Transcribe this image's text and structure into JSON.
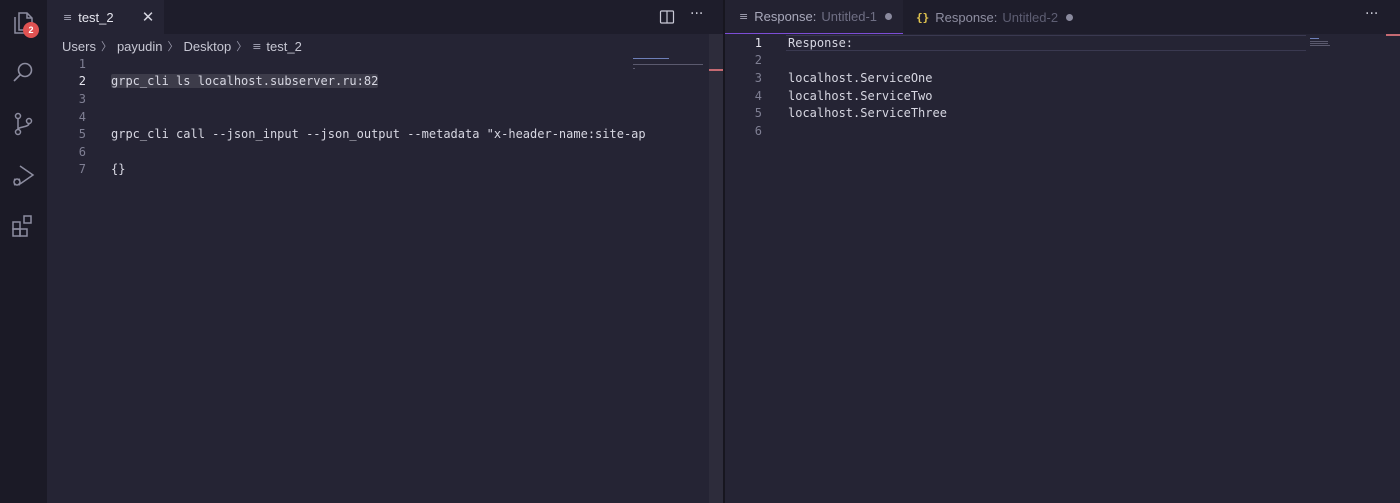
{
  "activity_bar": {
    "explorer_badge": "2",
    "icons": [
      "files-icon",
      "search-icon",
      "source-control-icon",
      "run-debug-icon",
      "extensions-icon"
    ]
  },
  "left_editor": {
    "tab": {
      "label": "test_2",
      "close": "✕"
    },
    "breadcrumb": [
      "Users",
      "payudin",
      "Desktop",
      "test_2"
    ],
    "lines": [
      {
        "num": "1",
        "text": ""
      },
      {
        "num": "2",
        "text": "grpc_cli ls localhost.subserver.ru:82"
      },
      {
        "num": "3",
        "text": ""
      },
      {
        "num": "4",
        "text": ""
      },
      {
        "num": "5",
        "text": "grpc_cli call --json_input --json_output --metadata \"x-header-name:site-ap"
      },
      {
        "num": "6",
        "text": ""
      },
      {
        "num": "7",
        "text": "{}"
      }
    ],
    "active_line": "2"
  },
  "right_editor": {
    "tabs": [
      {
        "label": "Response:",
        "sub": "Untitled-1",
        "icon": "lines-icon"
      },
      {
        "label": "Response:",
        "sub": "Untitled-2",
        "icon": "json-braces-icon",
        "icon_text": "{}"
      }
    ],
    "lines": [
      {
        "num": "1",
        "text": "Response:"
      },
      {
        "num": "2",
        "text": ""
      },
      {
        "num": "3",
        "text": "localhost.ServiceOne"
      },
      {
        "num": "4",
        "text": "localhost.ServiceTwo"
      },
      {
        "num": "5",
        "text": "localhost.ServiceThree"
      },
      {
        "num": "6",
        "text": ""
      }
    ],
    "active_line": "1"
  },
  "colors": {
    "accent": "#7c4dd6",
    "badge": "#e05252",
    "json_icon": "#e2c54f"
  },
  "more_label": "···"
}
